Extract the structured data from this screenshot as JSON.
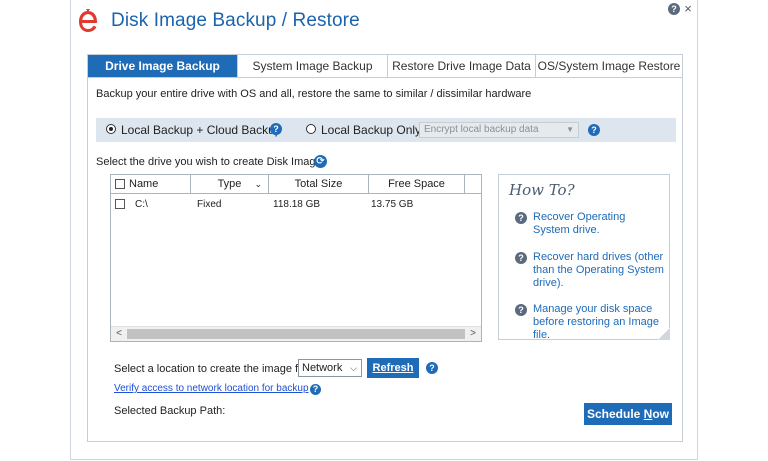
{
  "window": {
    "title": "Disk Image Backup / Restore",
    "help_glyph": "?",
    "close_glyph": "×"
  },
  "tabs": [
    {
      "label": "Drive Image Backup",
      "active": true
    },
    {
      "label": "System Image Backup",
      "active": false
    },
    {
      "label": "Restore Drive Image Data",
      "active": false
    },
    {
      "label": "OS/System Image Restore",
      "active": false
    }
  ],
  "description": "Backup your entire drive with OS and all, restore the same to similar / dissimilar hardware",
  "backup_options": {
    "local_cloud_label": "Local Backup + Cloud Backup",
    "local_only_label": "Local Backup Only",
    "selected": "local_cloud",
    "encrypt_placeholder": "Encrypt local backup data",
    "help_glyph": "?"
  },
  "drive_section": {
    "label": "Select the drive you wish to create Disk Image"
  },
  "drive_table": {
    "columns": [
      "Name",
      "Type",
      "Total Size",
      "Free Space"
    ],
    "rows": [
      {
        "name": "C:\\",
        "type": "Fixed",
        "total_size": "118.18 GB",
        "free_space": "13.75 GB"
      }
    ],
    "scroll_left": "<",
    "scroll_right": ">"
  },
  "howto": {
    "title": "How To?",
    "items": [
      "Recover Operating System drive.",
      "Recover hard drives (other than the Operating System drive).",
      "Manage your disk space before restoring an Image file."
    ]
  },
  "location": {
    "label": "Select a location to create the image file",
    "selected": "Network",
    "refresh_label": "Refresh",
    "verify_link": "Verify access to network location for backup",
    "path_label": "Selected Backup Path:"
  },
  "schedule": {
    "label_prefix": "Schedule ",
    "label_underlined": "N",
    "label_suffix": "ow"
  },
  "colors": {
    "accent": "#1e6bb8",
    "title": "#1b63ae",
    "logo": "#e03a2f",
    "option_bar": "#dde5ee"
  }
}
